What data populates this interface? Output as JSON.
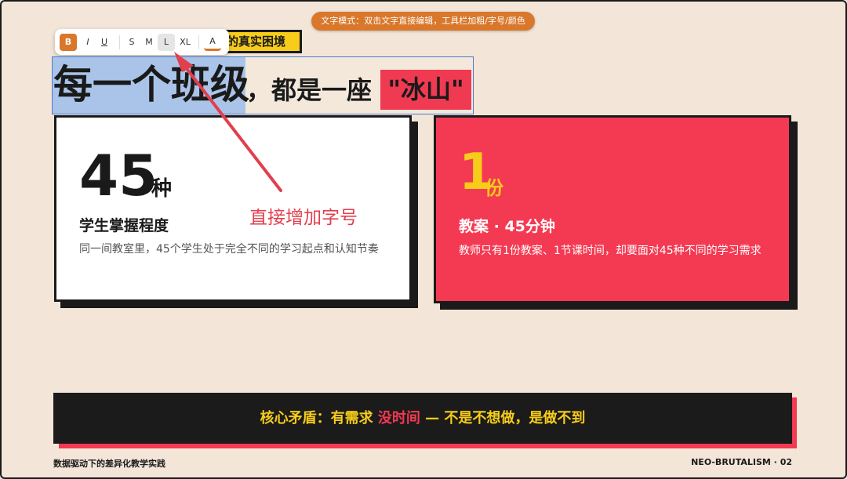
{
  "mode_hint": "文字模式：双击文字直接编辑，工具栏加粗/字号/颜色",
  "tag": {
    "label_visible": "的真实困境"
  },
  "toolbar": {
    "bold": "B",
    "italic": "I",
    "underline": "U",
    "size_s": "S",
    "size_m": "M",
    "size_l": "L",
    "size_xl": "XL",
    "color": "A",
    "active_size": "L",
    "accent_color": "#d9772a"
  },
  "heading": {
    "selected": "每一个班级",
    "rest": "，都是一座",
    "highlight": "\"冰山\""
  },
  "annotation": {
    "text": "直接增加字号",
    "color": "#e23f4e"
  },
  "cards": {
    "left": {
      "number": "45",
      "unit": "种",
      "title": "学生掌握程度",
      "desc": "同一间教室里，45个学生处于完全不同的学习起点和认知节奏"
    },
    "right": {
      "number": "1",
      "unit": "份",
      "title": "教案 · 45分钟",
      "desc": "教师只有1份教案、1节课时间，却要面对45种不同的学习需求"
    }
  },
  "bar": {
    "prefix": "核心矛盾：有需求",
    "red": "没时间",
    "suffix": "— 不是不想做，是做不到"
  },
  "footer": {
    "left": "数据驱动下的差异化教学实践",
    "right": "NEO-BRUTALISM · 02"
  },
  "colors": {
    "background": "#f3e6d8",
    "red": "#f43a52",
    "yellow": "#f7cc1a",
    "dark": "#1a1a1a",
    "selection": "#a9c4e8"
  }
}
